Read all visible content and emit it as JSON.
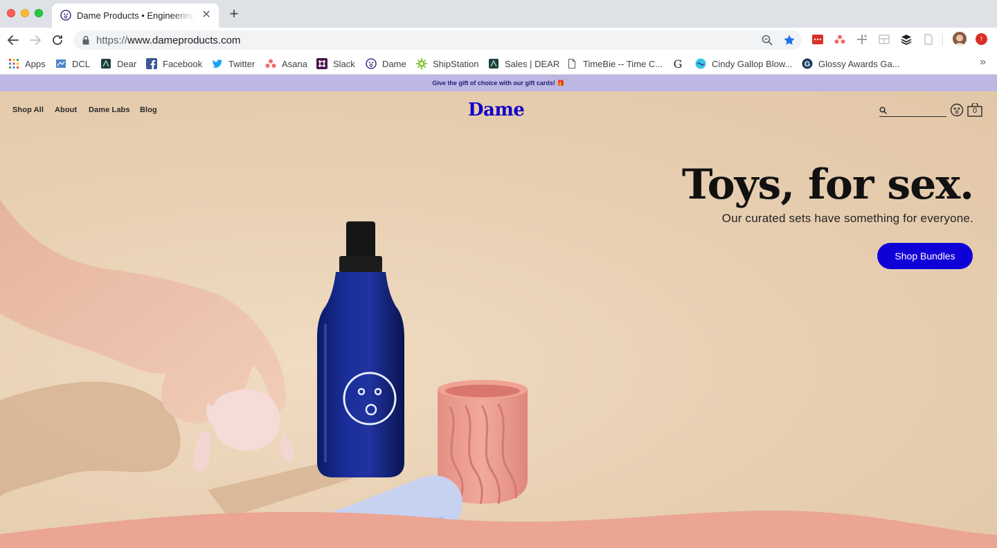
{
  "browser": {
    "tab": {
      "title": "Dame Products • Engineering for",
      "close": "✕"
    },
    "new_tab": "+",
    "url": {
      "scheme": "https://",
      "host": "www.dameproducts.com"
    },
    "bookmarks": [
      {
        "label": "Apps",
        "icon": "apps-grid-icon"
      },
      {
        "label": "DCL",
        "icon": "dcl-icon"
      },
      {
        "label": "Dear",
        "icon": "dear-icon"
      },
      {
        "label": "Facebook",
        "icon": "facebook-icon"
      },
      {
        "label": "Twitter",
        "icon": "twitter-icon"
      },
      {
        "label": "Asana",
        "icon": "asana-icon"
      },
      {
        "label": "Slack",
        "icon": "slack-icon"
      },
      {
        "label": "Dame",
        "icon": "dame-icon"
      },
      {
        "label": "ShipStation",
        "icon": "shipstation-icon"
      },
      {
        "label": "Sales | DEAR",
        "icon": "dear-icon"
      },
      {
        "label": "TimeBie -- Time C...",
        "icon": "document-icon"
      },
      {
        "label": "",
        "icon": "google-icon"
      },
      {
        "label": "Cindy Gallop Blow...",
        "icon": "cindy-icon"
      },
      {
        "label": "Glossy Awards Ga...",
        "icon": "glossy-icon"
      }
    ],
    "more": "»"
  },
  "site": {
    "announcement": "Give the gift of choice with our gift cards! 🎁",
    "nav": {
      "shop_all": "Shop All",
      "about": "About",
      "dame_labs": "Dame Labs",
      "blog": "Blog"
    },
    "logo": "Dame",
    "search_placeholder": "",
    "cart_count": "0",
    "hero": {
      "headline": "Toys, for sex.",
      "subhead": "Our curated sets have something for everyone.",
      "cta": "Shop Bundles"
    }
  },
  "colors": {
    "brand_blue": "#1000d8",
    "announcement_bg": "#bcb8e3",
    "hero_bg": "#e7cfb1"
  }
}
